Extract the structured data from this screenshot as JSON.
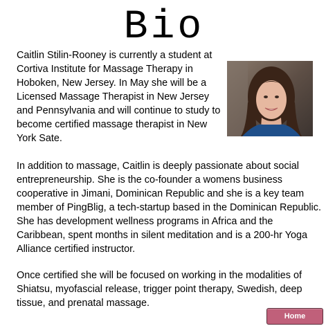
{
  "page": {
    "title": "Bio"
  },
  "bio": {
    "intro": "Caitlin Stilin-Rooney is currently a student at Cortiva Institute for Massage Therapy in Hoboken, New Jersey. In May she will be a Licensed Massage Therapist in New Jersey and Pennsylvania and will continue to study to become certified massage therapist in New York Sate.",
    "paragraph_2": "In addition to massage, Caitlin is deeply passionate about social entrepreneurship. She is the co-founder a womens business cooperative in Jimani, Dominican Republic and she is a key team member of PingBlig, a tech-startup based in the Dominican Republic. She has development wellness programs in Africa and the Caribbean, spent months in silent meditation and is a 200-hr Yoga Alliance certified instructor.",
    "paragraph_3": "Once certified she will be focused on working in the modalities of Shiatsu, myofascial release, trigger point therapy, Swedish, deep tissue, and prenatal massage."
  },
  "nav": {
    "home_label": "Home"
  },
  "colors": {
    "button_bg": "#c0607a",
    "button_border": "#5a2d3a",
    "text": "#000000",
    "background": "#ffffff"
  }
}
